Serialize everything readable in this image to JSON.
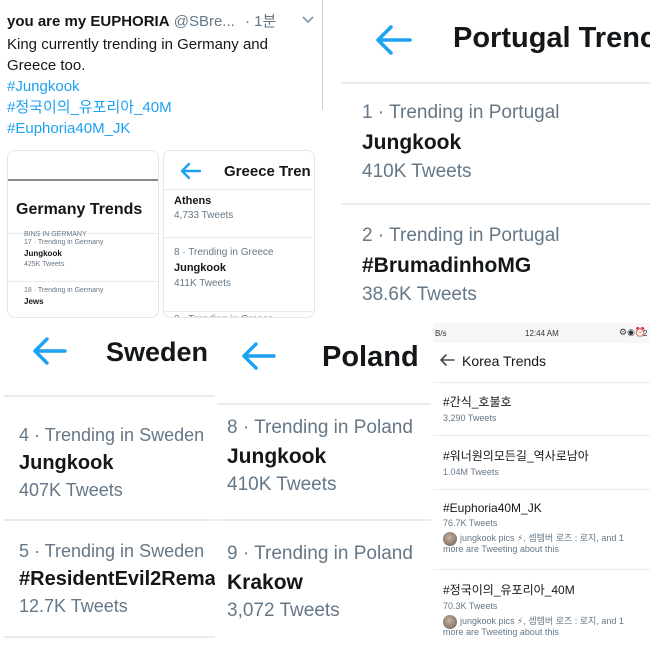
{
  "tweet": {
    "display_name": "you are my EUPHORIA",
    "handle": "@SBre...",
    "time": "· 1분",
    "chevron": "chevron-down-icon",
    "line1": "King currently trending in Germany and",
    "line2": "Greece too.",
    "hashtags": [
      "#Jungkook",
      "#정국이의_유포리아_40M",
      "#Euphoria40M_JK"
    ]
  },
  "germany": {
    "title": "Germany Trends",
    "partial_above": "BINS IN GERMANY",
    "items": [
      {
        "rank_label": "17 · Trending in Germany",
        "name": "Jungkook",
        "count": "425K Tweets"
      },
      {
        "rank_label": "18 · Trending in Germany",
        "name": "Jews",
        "count": ""
      }
    ]
  },
  "greece": {
    "title": "Greece Tren",
    "top_item": {
      "name": "Athens",
      "count": "4,733 Tweets"
    },
    "items": [
      {
        "rank_label": "8 · Trending in Greece",
        "name": "Jungkook",
        "count": "411K Tweets"
      }
    ],
    "partial_below": "9 · Trending in Greece"
  },
  "portugal": {
    "title": "Portugal Trenc",
    "items": [
      {
        "rank_label": "1 · Trending in Portugal",
        "name": "Jungkook",
        "count": "410K Tweets"
      },
      {
        "rank_label": "2 · Trending in Portugal",
        "name": "#BrumadinhoMG",
        "count": "38.6K Tweets"
      }
    ]
  },
  "sweden": {
    "title": "Sweden",
    "items": [
      {
        "rank_label": "4 · Trending in Sweden",
        "name": "Jungkook",
        "count": "407K Tweets"
      },
      {
        "rank_label": "5 · Trending in Sweden",
        "name": "#ResidentEvil2Rema",
        "count": "12.7K Tweets"
      }
    ]
  },
  "poland": {
    "title": "Poland",
    "items": [
      {
        "rank_label": "8 · Trending in Poland",
        "name": "Jungkook",
        "count": "410K Tweets"
      },
      {
        "rank_label": "9 · Trending in Poland",
        "name": "Krakow",
        "count": "3,072 Tweets"
      }
    ]
  },
  "korea": {
    "status_left": "B/s",
    "status_time": "12:44 AM",
    "status_right": "2",
    "title": "Korea Trends",
    "items": [
      {
        "name": "#간식_호불호",
        "count": "3,290 Tweets"
      },
      {
        "name": "#워너원의모든길_역사로남아",
        "count": "1.04M Tweets"
      },
      {
        "name": "#Euphoria40M_JK",
        "count": "76.7K Tweets",
        "social1": "jungkook pics ⚡, 셉템버 로즈 : 로지",
        "social2": "more are Tweeting about this"
      },
      {
        "name": "#정국이의_유포리아_40M",
        "count": "70.3K Tweets",
        "social1": "jungkook pics ⚡, 셉템버 로즈 : 로지",
        "social2": "more are Tweeting about this"
      }
    ],
    "social_suffix": ", and 1"
  },
  "icons": {
    "back": "back-arrow-icon",
    "avatar": "avatar"
  },
  "colors": {
    "twitter_blue": "#1da1f2",
    "text_dark": "#14171a",
    "text_gray": "#657786",
    "divider": "#e6ecf0"
  }
}
